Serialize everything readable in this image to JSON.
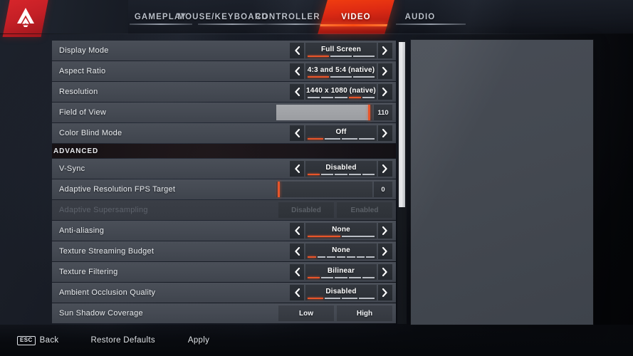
{
  "app": {
    "logo_name": "apex-legends-logo"
  },
  "nav": {
    "tabs": [
      {
        "label": "GAMEPLAY",
        "active": false
      },
      {
        "label": "MOUSE/KEYBOARD",
        "active": false
      },
      {
        "label": "CONTROLLER",
        "active": false
      },
      {
        "label": "VIDEO",
        "active": true
      },
      {
        "label": "AUDIO",
        "active": false
      }
    ],
    "active_tab": "VIDEO",
    "accent_color": "#e8552a",
    "brand_red": "#c41f26"
  },
  "settings": {
    "section_advanced_label": "ADVANCED",
    "rows": [
      {
        "label": "Display Mode",
        "type": "stepper",
        "value": "Full Screen",
        "segments": 3,
        "selected_index": 0,
        "disabled": false
      },
      {
        "label": "Aspect Ratio",
        "type": "stepper",
        "value": "4:3 and 5:4 (native)",
        "segments": 3,
        "selected_index": 0,
        "disabled": false
      },
      {
        "label": "Resolution",
        "type": "stepper",
        "value": "1440 x 1080 (native)",
        "segments": 5,
        "selected_index": 3,
        "disabled": false
      },
      {
        "label": "Field of View",
        "type": "slider",
        "value": "110",
        "fill_percent": 97,
        "disabled": false
      },
      {
        "label": "Color Blind Mode",
        "type": "stepper",
        "value": "Off",
        "segments": 4,
        "selected_index": 0,
        "disabled": false
      },
      {
        "label": "V-Sync",
        "type": "stepper",
        "value": "Disabled",
        "segments": 5,
        "selected_index": 0,
        "disabled": false,
        "section": "ADVANCED"
      },
      {
        "label": "Adaptive Resolution FPS Target",
        "type": "slider",
        "value": "0",
        "fill_percent": 0,
        "disabled": false
      },
      {
        "label": "Adaptive Supersampling",
        "type": "dual",
        "options": [
          "Disabled",
          "Enabled"
        ],
        "selected_index": 0,
        "disabled": true
      },
      {
        "label": "Anti-aliasing",
        "type": "stepper",
        "value": "None",
        "segments": 2,
        "selected_index": 0,
        "disabled": false
      },
      {
        "label": "Texture Streaming Budget",
        "type": "stepper",
        "value": "None",
        "segments": 7,
        "selected_index": 0,
        "disabled": false
      },
      {
        "label": "Texture Filtering",
        "type": "stepper",
        "value": "Bilinear",
        "segments": 5,
        "selected_index": 0,
        "disabled": false
      },
      {
        "label": "Ambient Occlusion Quality",
        "type": "stepper",
        "value": "Disabled",
        "segments": 4,
        "selected_index": 0,
        "disabled": false
      },
      {
        "label": "Sun Shadow Coverage",
        "type": "dual",
        "options": [
          "Low",
          "High"
        ],
        "selected_index": 0,
        "disabled": false
      }
    ]
  },
  "scrollbar": {
    "thumb_position_percent": 0,
    "thumb_size_percent": 59
  },
  "footer": {
    "back_key": "ESC",
    "back_label": "Back",
    "restore_defaults_label": "Restore Defaults",
    "apply_label": "Apply"
  },
  "icons": {
    "left_arrow": "chevron-left-icon",
    "right_arrow": "chevron-right-icon"
  }
}
